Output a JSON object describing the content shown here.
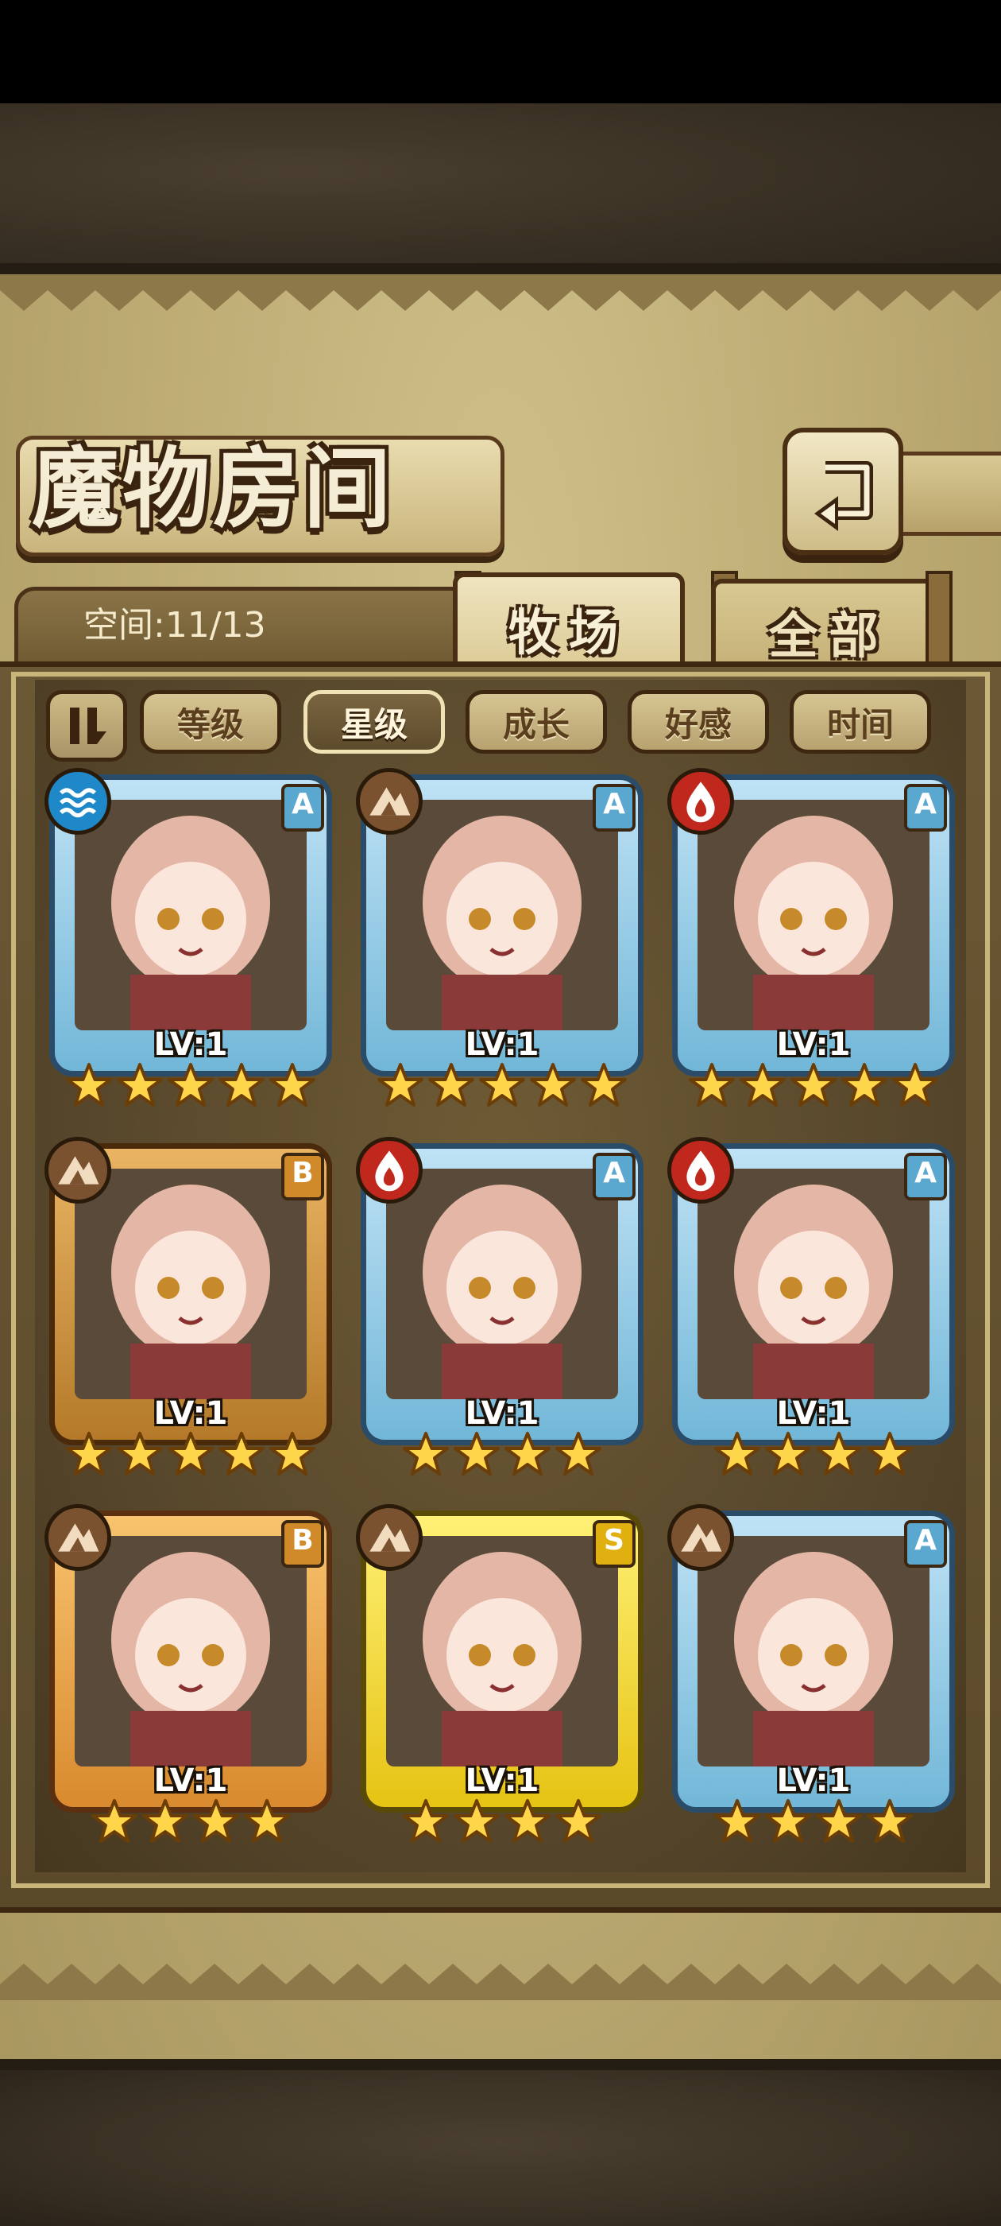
{
  "title": "魔物房间",
  "space_label": "空间:11/13",
  "tabs": {
    "farm": "牧场",
    "all": "全部"
  },
  "sort": {
    "buttons": [
      {
        "label": "等级",
        "active": false
      },
      {
        "label": "星级",
        "active": true
      },
      {
        "label": "成长",
        "active": false
      },
      {
        "label": "好感",
        "active": false
      },
      {
        "label": "时间",
        "active": false
      }
    ]
  },
  "cards": [
    {
      "element": "water",
      "rank": "A",
      "level": "LV:1",
      "stars": 5,
      "frame": "blue"
    },
    {
      "element": "earth",
      "rank": "A",
      "level": "LV:1",
      "stars": 5,
      "frame": "blue"
    },
    {
      "element": "fire",
      "rank": "A",
      "level": "LV:1",
      "stars": 5,
      "frame": "blue"
    },
    {
      "element": "earth",
      "rank": "B",
      "level": "LV:1",
      "stars": 5,
      "frame": "bronze"
    },
    {
      "element": "fire",
      "rank": "A",
      "level": "LV:1",
      "stars": 4,
      "frame": "blue"
    },
    {
      "element": "fire",
      "rank": "A",
      "level": "LV:1",
      "stars": 4,
      "frame": "blue"
    },
    {
      "element": "earth",
      "rank": "B",
      "level": "LV:1",
      "stars": 4,
      "frame": "orange"
    },
    {
      "element": "earth",
      "rank": "S",
      "level": "LV:1",
      "stars": 4,
      "frame": "yellow"
    },
    {
      "element": "earth",
      "rank": "A",
      "level": "LV:1",
      "stars": 4,
      "frame": "blue"
    }
  ],
  "icons": {
    "back": "return-arrow-icon",
    "sort_toggle": "sort-toggle-icon",
    "water": "water-element-icon",
    "earth": "earth-element-icon",
    "fire": "fire-element-icon",
    "star": "star-icon"
  },
  "colors": {
    "water": "#1e88c8",
    "earth": "#7a5230",
    "fire": "#c0281e",
    "star": "#ffd54a"
  }
}
